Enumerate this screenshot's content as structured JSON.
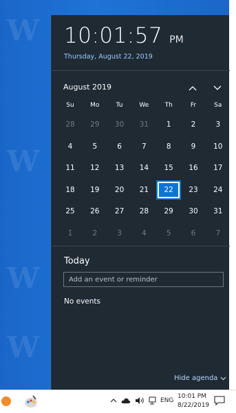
{
  "flyout": {
    "time": "10:01:57",
    "ampm": "PM",
    "date": "Thursday, August 22, 2019"
  },
  "calendar": {
    "month_label": "August 2019",
    "nav_up_icon": "chevron-up-icon",
    "nav_down_icon": "chevron-down-icon",
    "weekdays": [
      "Su",
      "Mo",
      "Tu",
      "We",
      "Th",
      "Fr",
      "Sa"
    ],
    "weeks": [
      [
        "28",
        "29",
        "30",
        "31",
        "1",
        "2",
        "3"
      ],
      [
        "4",
        "5",
        "6",
        "7",
        "8",
        "9",
        "10"
      ],
      [
        "11",
        "12",
        "13",
        "14",
        "15",
        "16",
        "17"
      ],
      [
        "18",
        "19",
        "20",
        "21",
        "22",
        "23",
        "24"
      ],
      [
        "25",
        "26",
        "27",
        "28",
        "29",
        "30",
        "31"
      ],
      [
        "1",
        "2",
        "3",
        "4",
        "5",
        "6",
        "7"
      ]
    ],
    "today": "22"
  },
  "agenda": {
    "title": "Today",
    "input_placeholder": "Add an event or reminder",
    "no_events": "No events",
    "hide_label": "Hide agenda"
  },
  "taskbar": {
    "lang": "ENG",
    "time": "10:01 PM",
    "date": "8/22/2019"
  },
  "colors": {
    "flyout_bg": "#1f2a33",
    "accent": "#0c74d6",
    "link": "#9ecbff"
  }
}
